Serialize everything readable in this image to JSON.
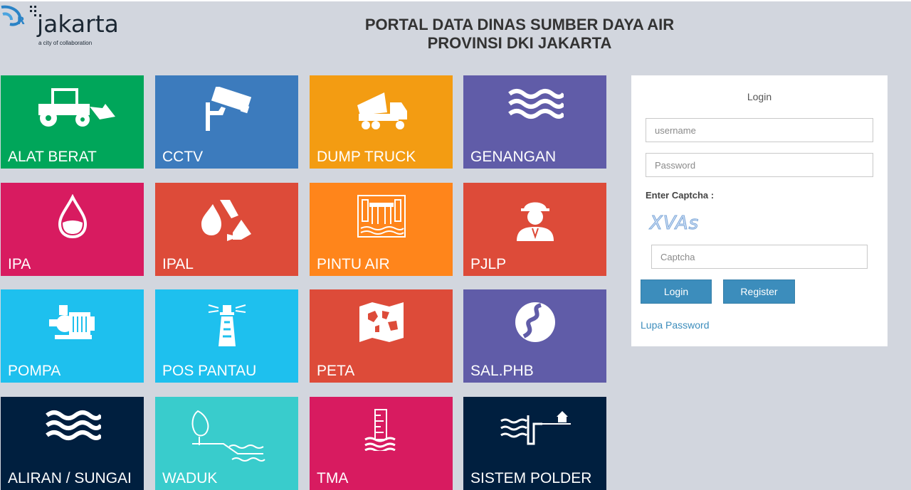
{
  "header": {
    "logo_text": "jakarta",
    "logo_tagline": "a city of collaboration",
    "title_line1": "PORTAL DATA DINAS SUMBER DAYA AIR",
    "title_line2": "PROVINSI DKI JAKARTA"
  },
  "tiles": [
    {
      "label": "ALAT BERAT",
      "icon": "loader-icon",
      "color": "#00a65a"
    },
    {
      "label": "CCTV",
      "icon": "cctv-camera-icon",
      "color": "#3c7bbd"
    },
    {
      "label": "DUMP TRUCK",
      "icon": "dump-truck-icon",
      "color": "#f39c12"
    },
    {
      "label": "GENANGAN",
      "icon": "water-waves-icon",
      "color": "#605ca8"
    },
    {
      "label": "IPA",
      "icon": "water-drop-icon",
      "color": "#d81b60"
    },
    {
      "label": "IPAL",
      "icon": "recycle-water-icon",
      "color": "#dd4b39"
    },
    {
      "label": "PINTU AIR",
      "icon": "water-gate-icon",
      "color": "#ff851b"
    },
    {
      "label": "PJLP",
      "icon": "worker-icon",
      "color": "#dd4b39"
    },
    {
      "label": "POMPA",
      "icon": "pump-icon",
      "color": "#1ec0ee"
    },
    {
      "label": "POS PANTAU",
      "icon": "lighthouse-icon",
      "color": "#1ec0ee"
    },
    {
      "label": "PETA",
      "icon": "map-icon",
      "color": "#dd4b39"
    },
    {
      "label": "SAL.PHB",
      "icon": "river-icon",
      "color": "#605ca8"
    },
    {
      "label": "ALIRAN / SUNGAI",
      "icon": "water-waves-icon",
      "color": "#001f3f"
    },
    {
      "label": "WADUK",
      "icon": "reservoir-icon",
      "color": "#39cccc"
    },
    {
      "label": "TMA",
      "icon": "water-level-gauge-icon",
      "color": "#d81b60"
    },
    {
      "label": "SISTEM POLDER",
      "icon": "polder-icon",
      "color": "#001f3f"
    }
  ],
  "login": {
    "title": "Login",
    "username_placeholder": "username",
    "password_placeholder": "Password",
    "captcha_label": "Enter Captcha :",
    "captcha_text": "XVAs",
    "captcha_placeholder": "Captcha",
    "login_button": "Login",
    "register_button": "Register",
    "forgot_link": "Lupa Password"
  }
}
